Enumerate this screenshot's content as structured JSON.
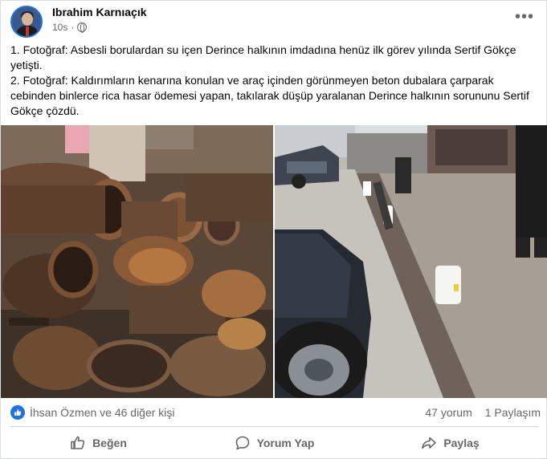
{
  "post": {
    "author": "Ibrahim Karnıaçık",
    "time": "10s",
    "paragraph1": "1. Fotoğraf: Asbesli borulardan su içen Derince halkının imdadına henüz ilk görev yılında Sertif Gökçe yetişti.",
    "paragraph2": "2. Fotoğraf: Kaldırımların kenarına konulan ve araç içinden görünmeyen beton dubalara çarparak cebinden binlerce rica hasar ödemesi yapan, takılarak düşüp yaralanan Derince halkının sorununu Sertif Gökçe çözdü."
  },
  "reactions": {
    "summary": "İhsan Özmen ve 46 diğer kişi",
    "comments": "47 yorum",
    "shares": "1 Paylaşım"
  },
  "actions": {
    "like": "Beğen",
    "comment": "Yorum Yap",
    "share": "Paylaş"
  },
  "colors": {
    "accent": "#1b74e4",
    "secondary_text": "#65676b"
  },
  "icons": [
    "globe-icon",
    "more-options-icon",
    "like-reaction-icon",
    "like-icon",
    "comment-icon",
    "share-icon"
  ]
}
